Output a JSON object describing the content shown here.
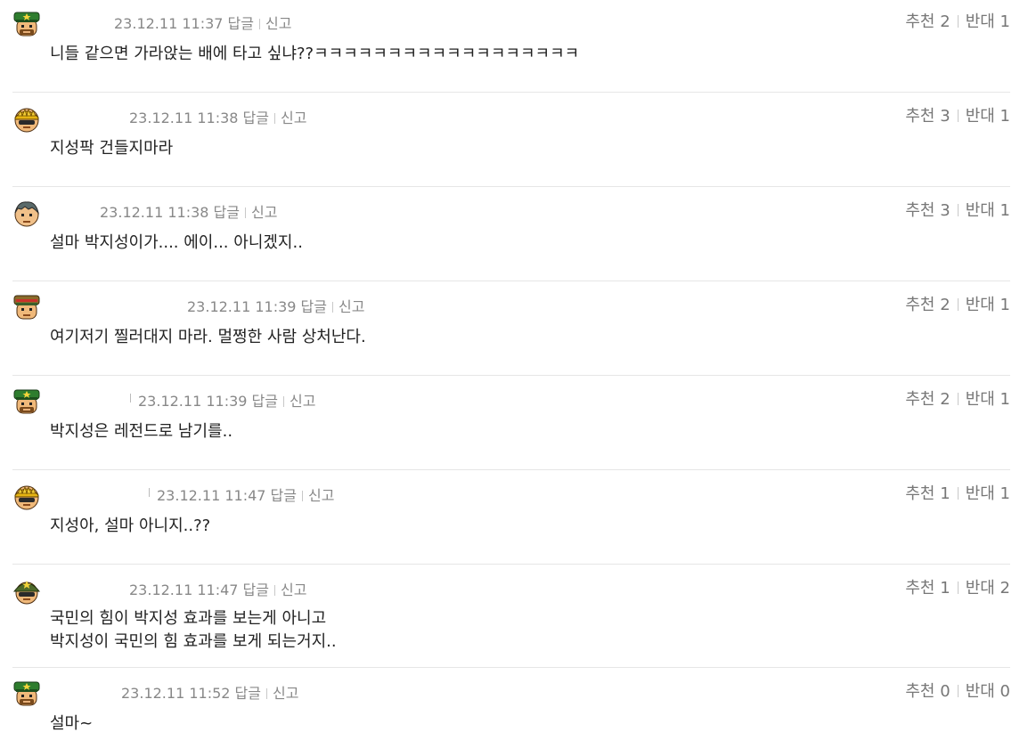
{
  "labels": {
    "reply": "답글",
    "report": "신고",
    "recommend": "추천",
    "oppose": "반대"
  },
  "comments": [
    {
      "avatar": "green-officer-cap-avatar",
      "time": "23.12.11 11:37",
      "lines": [
        "니들 같으면 가라앉는 배에 타고 싶냐??ㅋㅋㅋㅋㅋㅋㅋㅋㅋㅋㅋㅋㅋㅋㅋㅋㅋㅋ"
      ],
      "up": "2",
      "down": "1"
    },
    {
      "avatar": "yellow-helmet-avatar",
      "time": "23.12.11 11:38",
      "lines": [
        "지성팍 건들지마라"
      ],
      "up": "3",
      "down": "1"
    },
    {
      "avatar": "grey-soldier-avatar",
      "time": "23.12.11 11:38",
      "lines": [
        "설마 박지성이가.... 에이... 아니겠지.."
      ],
      "up": "3",
      "down": "1"
    },
    {
      "avatar": "red-officer-cap-avatar",
      "time": "23.12.11 11:39",
      "lines": [
        "여기저기 찔러대지 마라. 멀쩡한 사람 상처난다."
      ],
      "up": "2",
      "down": "1"
    },
    {
      "avatar": "green-officer-cap-avatar",
      "time": "23.12.11 11:39",
      "lines": [
        "박지성은 레전드로 남기를.."
      ],
      "up": "2",
      "down": "1"
    },
    {
      "avatar": "yellow-helmet-avatar",
      "time": "23.12.11 11:47",
      "lines": [
        "지성아, 설마 아니지..??"
      ],
      "up": "1",
      "down": "1"
    },
    {
      "avatar": "army-helmet-avatar",
      "time": "23.12.11 11:47",
      "lines": [
        "국민의 힘이 박지성 효과를 보는게 아니고",
        "박지성이 국민의 힘 효과를 보게 되는거지.."
      ],
      "up": "1",
      "down": "2"
    },
    {
      "avatar": "green-officer-cap-avatar",
      "time": "23.12.11 11:52",
      "lines": [
        "설마~"
      ],
      "up": "0",
      "down": "0"
    }
  ]
}
